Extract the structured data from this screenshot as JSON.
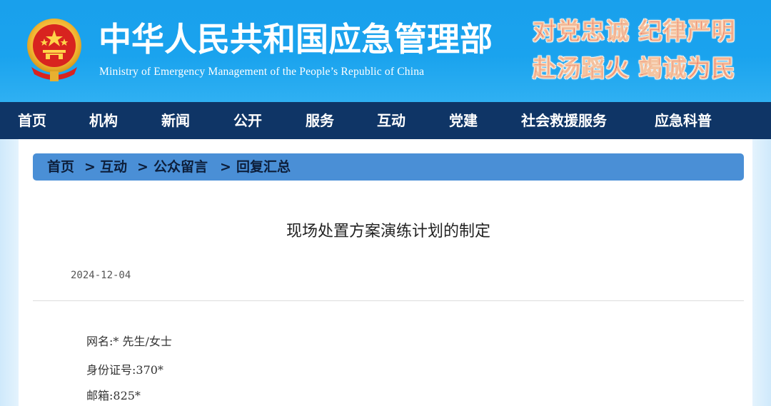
{
  "header": {
    "title_cn": "中华人民共和国应急管理部",
    "title_en": "Ministry of Emergency Management of the People’s Republic of China",
    "slogan_line1": "对党忠诚 纪律严明",
    "slogan_line2": "赴汤蹈火 竭诚为民",
    "emblem_icon": "national-emblem-icon"
  },
  "nav": {
    "items": [
      "首页",
      "机构",
      "新闻",
      "公开",
      "服务",
      "互动",
      "党建",
      "社会救援服务",
      "应急科普"
    ]
  },
  "breadcrumb": {
    "items": [
      "首页",
      "互动",
      "公众留言",
      "回复汇总"
    ],
    "separator": ">"
  },
  "article": {
    "title": "现场处置方案演练计划的制定",
    "date": "2024-12-04",
    "fields": [
      "网名:* 先生/女士",
      "身份证号:370*",
      "邮箱:825*"
    ]
  },
  "colors": {
    "header_blue": "#1aa3ee",
    "nav_navy": "#0f3566",
    "breadcrumb_blue": "#4a8fd6",
    "slogan_red": "#e9262a"
  }
}
